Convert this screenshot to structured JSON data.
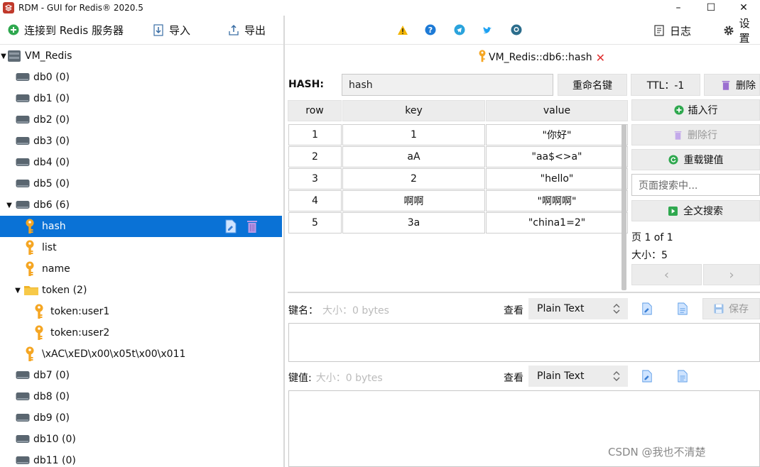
{
  "window": {
    "title": "RDM - GUI for Redis® 2020.5",
    "min": "–",
    "max": "☐",
    "close": "✕"
  },
  "toolbar": {
    "connect_label": "连接到 Redis 服务器",
    "import_label": "导入",
    "export_label": "导出",
    "log_label": "日志",
    "settings_label": "设置"
  },
  "tree": {
    "server": "VM_Redis",
    "databases_top": [
      "db0  (0)",
      "db1  (0)",
      "db2  (0)",
      "db3  (0)",
      "db4  (0)",
      "db5  (0)"
    ],
    "db6": "db6  (6)",
    "keys": [
      "hash",
      "list",
      "name"
    ],
    "folder": "token (2)",
    "folder_keys": [
      "token:user1",
      "token:user2"
    ],
    "binary_key": "\\xAC\\xED\\x00\\x05t\\x00\\x011",
    "databases_bottom": [
      "db7  (0)",
      "db8  (0)",
      "db9  (0)",
      "db10  (0)",
      "db11  (0)"
    ]
  },
  "tab": {
    "label": "VM_Redis::db6::hash",
    "close": "✕"
  },
  "key": {
    "type_label": "HASH:",
    "name": "hash",
    "rename_label": "重命名键",
    "ttl_label": "TTL：-1",
    "delete_label": "删除"
  },
  "table": {
    "headers": [
      "row",
      "key",
      "value"
    ],
    "rows": [
      {
        "row": "1",
        "key": "1",
        "value": "\"你好\""
      },
      {
        "row": "2",
        "key": "aA",
        "value": "\"aa$<>a\""
      },
      {
        "row": "3",
        "key": "2",
        "value": "\"hello\""
      },
      {
        "row": "4",
        "key": "啊啊",
        "value": "\"啊啊啊\""
      },
      {
        "row": "5",
        "key": "3a",
        "value": "\"china1=2\""
      }
    ]
  },
  "side": {
    "insert_label": "插入行",
    "delete_row_label": "删除行",
    "reload_label": "重载键值",
    "search_placeholder": "页面搜索中...",
    "fulltext_label": "全文搜索",
    "page_info": "页  1  of 1",
    "size_info": "大小：5",
    "prev": "‹",
    "next": "›"
  },
  "key_editor": {
    "label": "键名：",
    "size": "大小：0 bytes",
    "view_label": "查看",
    "format": "Plain Text",
    "save_label": "保存"
  },
  "value_editor": {
    "label": "键值:",
    "size": "大小：0 bytes",
    "view_label": "查看",
    "format": "Plain Text"
  },
  "watermark": "CSDN @我也不清楚",
  "colors": {
    "selected": "#0a72d6",
    "key_icon": "#f5a623",
    "trash": "#9b6fd0",
    "green": "#2fa84f"
  }
}
